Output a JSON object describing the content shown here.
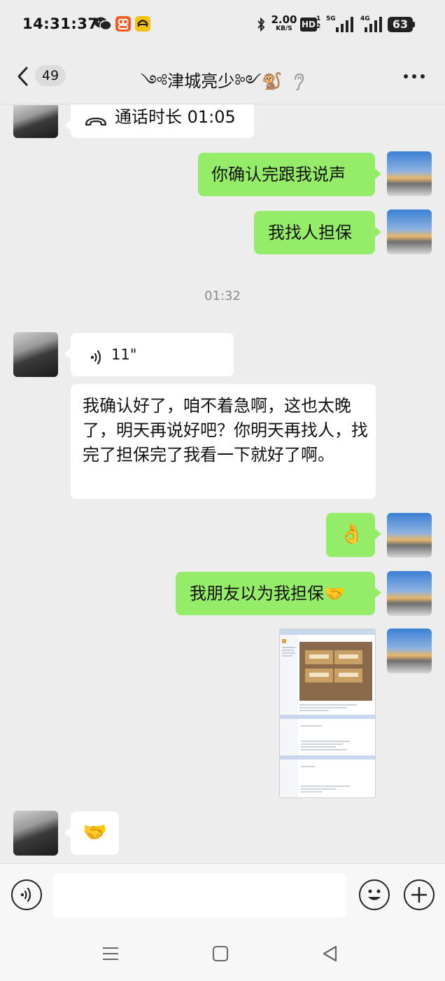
{
  "status_bar": {
    "time": "14:31:37",
    "net_speed_value": "2.00",
    "net_speed_unit": "KB/S",
    "hd": "HD",
    "hd_sub": "1\n2",
    "signal1_label": "5G",
    "signal2_label": "4G",
    "battery": "63"
  },
  "header": {
    "unread_count": "49",
    "title": "༺津城亮少༻🐒",
    "ear_icon": "ear-icon"
  },
  "messages": {
    "call": {
      "label": "通话时长 01:05"
    },
    "m1": "你确认完跟我说声",
    "m2": "我找人担保",
    "timestamp": "01:32",
    "voice": {
      "duration": "11\""
    },
    "m3": "我确认好了，咱不着急啊，这也太晚了，明天再说好吧？你明天再找人，找完了担保完了我看一下就好了啊。",
    "m4_emoji": "👌",
    "m5": "我朋友以为我担保🤝",
    "m6_emoji": "🤝"
  },
  "colors": {
    "bg": "#ededed",
    "bubble_green": "#95ec69",
    "bubble_white": "#ffffff"
  }
}
